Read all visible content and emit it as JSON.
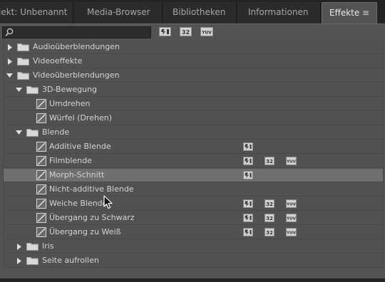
{
  "tabs": [
    {
      "label": "jekt: Unbenannt"
    },
    {
      "label": "Media-Browser"
    },
    {
      "label": "Bibliotheken"
    },
    {
      "label": "Informationen"
    },
    {
      "label": "Effekte"
    }
  ],
  "tab_menu_icon": "hamburger-menu-icon",
  "toolbar": {
    "search_value": "",
    "accel_label": "",
    "bit32_label": "32",
    "yuv_label": "YUV"
  },
  "tree": [
    {
      "label": "Audioüberblendungen",
      "kind": "folder",
      "expanded": false
    },
    {
      "label": "Videoeffekte",
      "kind": "folder",
      "expanded": false
    },
    {
      "label": "Videoüberblendungen",
      "kind": "folder",
      "expanded": true
    },
    {
      "label": "3D-Bewegung",
      "kind": "folder",
      "expanded": true
    },
    {
      "label": "Umdrehen",
      "kind": "effect"
    },
    {
      "label": "Würfel (Drehen)",
      "kind": "effect"
    },
    {
      "label": "Blende",
      "kind": "folder",
      "expanded": true
    },
    {
      "label": "Additive Blende",
      "kind": "effect",
      "accelerated": true
    },
    {
      "label": "Filmblende",
      "kind": "effect",
      "accelerated": true,
      "bit32": true,
      "yuv": true
    },
    {
      "label": "Morph-Schnitt",
      "kind": "effect",
      "accelerated": true,
      "selected": true
    },
    {
      "label": "Nicht-additive Blende",
      "kind": "effect"
    },
    {
      "label": "Weiche Blende",
      "kind": "effect",
      "accelerated": true,
      "bit32": true,
      "yuv": true
    },
    {
      "label": "Übergang zu Schwarz",
      "kind": "effect",
      "accelerated": true,
      "bit32": true,
      "yuv": true
    },
    {
      "label": "Übergang zu Weiß",
      "kind": "effect",
      "accelerated": true,
      "bit32": true,
      "yuv": true
    },
    {
      "label": "Iris",
      "kind": "folder",
      "expanded": false
    },
    {
      "label": "Seite aufrollen",
      "kind": "folder",
      "expanded": false
    }
  ],
  "colors": {
    "panel": "#535353",
    "selected_row": "#6f6f6f",
    "tab_active": "#535353",
    "app_bg": "#232323"
  }
}
